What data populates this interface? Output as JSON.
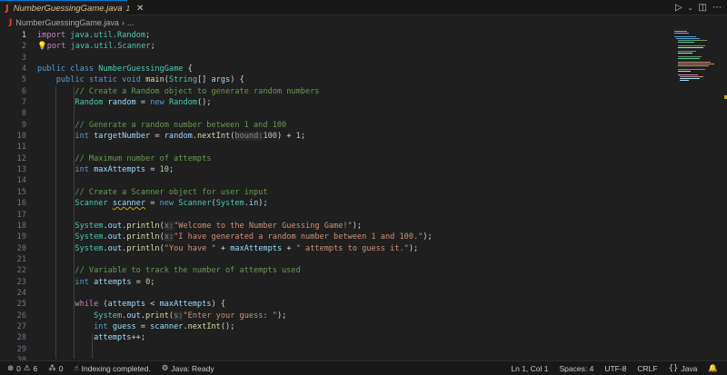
{
  "tab": {
    "file_name": "NumberGuessingGame.java",
    "problem_count": "1",
    "close_icon": "close-icon"
  },
  "title_actions": {
    "run": "run-icon",
    "split": "split-editor-icon",
    "more": "more-icon"
  },
  "breadcrumb": {
    "file": "NumberGuessingGame.java",
    "more": "..."
  },
  "line_numbers": [
    "1",
    "2",
    "3",
    "4",
    "5",
    "6",
    "7",
    "8",
    "9",
    "10",
    "11",
    "12",
    "13",
    "14",
    "15",
    "16",
    "17",
    "18",
    "19",
    "20",
    "21",
    "22",
    "23",
    "24",
    "25",
    "26",
    "27",
    "28",
    "29",
    "30"
  ],
  "code": {
    "l1_kw": "import",
    "l1_pkg": "java.util.",
    "l1_cls": "Random",
    "l2_kw": "port",
    "l2_pkg": "java.util.",
    "l2_cls": "Scanner",
    "l4_kw1": "public",
    "l4_kw2": "class",
    "l4_cls": "NumberGuessingGame",
    "l5_kw1": "public",
    "l5_kw2": "static",
    "l5_kw3": "void",
    "l5_fn": "main",
    "l5_type": "String",
    "l5_arg": "args",
    "l6_cmt": "// Create a Random object to generate random numbers",
    "l7_type": "Random",
    "l7_var": "random",
    "l7_kw": "new",
    "l7_cls": "Random",
    "l9_cmt": "// Generate a random number between 1 and 100",
    "l10_kw": "int",
    "l10_var": "targetNumber",
    "l10_obj": "random",
    "l10_fn": "nextInt",
    "l10_hint": "bound:",
    "l10_num1": "100",
    "l10_num2": "1",
    "l12_cmt": "// Maximum number of attempts",
    "l13_kw": "int",
    "l13_var": "maxAttempts",
    "l13_num": "10",
    "l15_cmt": "// Create a Scanner object for user input",
    "l16_type": "Scanner",
    "l16_var": "scanner",
    "l16_kw": "new",
    "l16_cls": "Scanner",
    "l16_sys": "System",
    "l16_in": "in",
    "print_sys": "System",
    "print_out": "out",
    "println": "println",
    "print": "print",
    "l18_hint": "x:",
    "l18_str": "\"Welcome to the Number Guessing Game!\"",
    "l19_hint": "x:",
    "l19_str": "\"I have generated a random number between 1 and 100.\"",
    "l20_str1": "\"You have \"",
    "l20_var": "maxAttempts",
    "l20_str2": "\" attempts to guess it.\"",
    "l22_cmt": "// Variable to track the number of attempts used",
    "l23_kw": "int",
    "l23_var": "attempts",
    "l23_num": "0",
    "l25_kw": "while",
    "l25_var1": "attempts",
    "l25_var2": "maxAttempts",
    "l26_hint": "s:",
    "l26_str": "\"Enter your guess: \"",
    "l27_kw": "int",
    "l27_var": "guess",
    "l27_obj": "scanner",
    "l27_fn": "nextInt",
    "l28_var": "attempts"
  },
  "status": {
    "errors": "0",
    "warnings": "6",
    "ports": "0",
    "indexing": "Indexing completed.",
    "java": "Java: Ready",
    "position": "Ln 1, Col 1",
    "spaces": "Spaces: 4",
    "encoding": "UTF-8",
    "eol": "CRLF",
    "language": "Java"
  },
  "colors": {
    "accent": "#0078d4",
    "keyword": "#569cd6",
    "type": "#4ec9b0",
    "string": "#ce9178",
    "comment": "#6a9955",
    "number": "#b5cea8",
    "variable": "#9cdcfe",
    "function": "#dcdcaa"
  }
}
